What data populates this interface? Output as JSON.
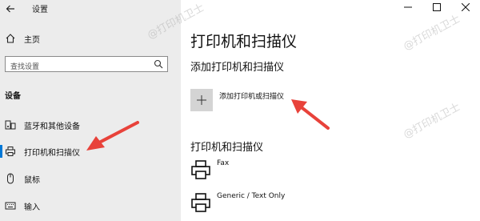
{
  "window": {
    "title": "设置"
  },
  "sidebar": {
    "home_label": "主页",
    "search_placeholder": "查找设置",
    "section_label": "设备",
    "items": [
      {
        "label": "蓝牙和其他设备",
        "icon": "bluetooth-devices-icon"
      },
      {
        "label": "打印机和扫描仪",
        "icon": "printer-icon",
        "selected": true
      },
      {
        "label": "鼠标",
        "icon": "mouse-icon"
      },
      {
        "label": "输入",
        "icon": "keyboard-icon"
      }
    ]
  },
  "main": {
    "title": "打印机和扫描仪",
    "add_section": "添加打印机和扫描仪",
    "add_button_label": "添加打印机或扫描仪",
    "printers_section": "打印机和扫描仪",
    "printers": [
      {
        "name": "Fax"
      },
      {
        "name": "Generic / Text Only"
      }
    ]
  },
  "watermark": "@打印机卫士",
  "colors": {
    "accent": "#0078d7",
    "arrow": "#e8423a",
    "sidebar_bg": "#ececec"
  }
}
